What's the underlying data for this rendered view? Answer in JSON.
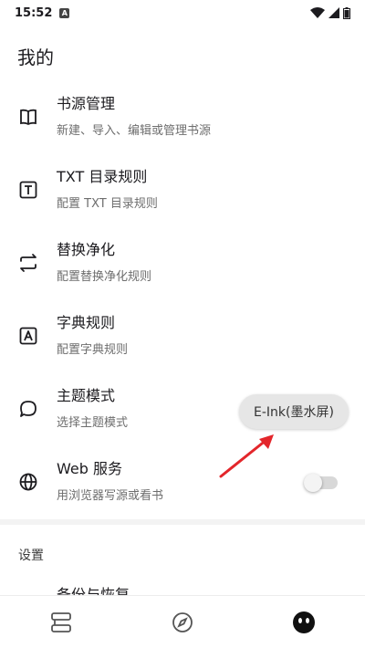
{
  "status_bar": {
    "time": "15:52",
    "notification_icon": "A-icon"
  },
  "page": {
    "title": "我的"
  },
  "menu": [
    {
      "id": "book-source",
      "icon": "book-open-icon",
      "title": "书源管理",
      "subtitle": "新建、导入、编辑或管理书源"
    },
    {
      "id": "txt-toc",
      "icon": "text-box-icon",
      "title": "TXT 目录规则",
      "subtitle": "配置 TXT 目录规则"
    },
    {
      "id": "replace",
      "icon": "swap-arrows-icon",
      "title": "替换净化",
      "subtitle": "配置替换净化规则"
    },
    {
      "id": "dict",
      "icon": "letter-a-box-icon",
      "title": "字典规则",
      "subtitle": "配置字典规则"
    },
    {
      "id": "theme",
      "icon": "speech-bubble-icon",
      "title": "主题模式",
      "subtitle": "选择主题模式"
    },
    {
      "id": "web",
      "icon": "globe-icon",
      "title": "Web 服务",
      "subtitle": "用浏览器写源或看书"
    }
  ],
  "theme_chip": {
    "label": "E-Ink(墨水屏)"
  },
  "web_toggle": {
    "on": false
  },
  "section": {
    "settings_header": "设置",
    "partial_item": "备份与恢复"
  },
  "colors": {
    "arrow": "#e3262b",
    "toggle_track": "#d8d8d8",
    "chip_bg": "#e6e6e6"
  }
}
